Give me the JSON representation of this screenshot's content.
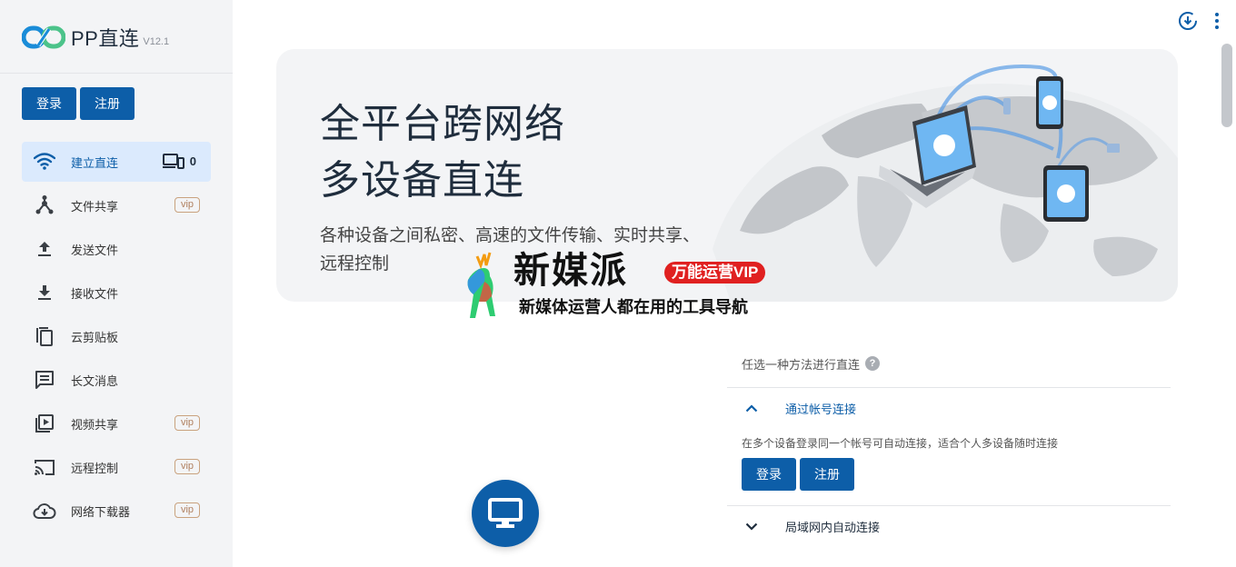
{
  "app": {
    "name": "PP直连",
    "version": "V12.1"
  },
  "auth": {
    "login_label": "登录",
    "register_label": "注册"
  },
  "sidebar": {
    "items": [
      {
        "label": "建立直连",
        "icon": "wifi-icon",
        "active": true,
        "device_count": "0"
      },
      {
        "label": "文件共享",
        "icon": "share-icon",
        "vip": "vip"
      },
      {
        "label": "发送文件",
        "icon": "upload-icon"
      },
      {
        "label": "接收文件",
        "icon": "download-icon"
      },
      {
        "label": "云剪贴板",
        "icon": "clipboard-icon"
      },
      {
        "label": "长文消息",
        "icon": "message-icon"
      },
      {
        "label": "视频共享",
        "icon": "video-icon",
        "vip": "vip"
      },
      {
        "label": "远程控制",
        "icon": "cast-icon",
        "vip": "vip"
      },
      {
        "label": "网络下载器",
        "icon": "cloud-download-icon",
        "vip": "vip"
      }
    ]
  },
  "hero": {
    "title_line1": "全平台跨网络",
    "title_line2": "多设备直连",
    "subtitle": "各种设备之间私密、高速的文件传输、实时共享、远程控制"
  },
  "watermark": {
    "brand": "新媒派",
    "badge": "万能运营VIP",
    "tagline": "新媒体运营人都在用的工具导航"
  },
  "connect": {
    "hint": "任选一种方法进行直连",
    "help": "?",
    "methods": [
      {
        "title": "通过帐号连接",
        "expanded": true,
        "description": "在多个设备登录同一个帐号可自动连接，适合个人多设备随时连接",
        "login_label": "登录",
        "register_label": "注册"
      },
      {
        "title": "局域网内自动连接",
        "expanded": false
      }
    ]
  },
  "colors": {
    "primary": "#0d5ea8",
    "active_bg": "#dbeafd",
    "sidebar_bg": "#f3f4f6",
    "vip": "#c9a27e",
    "logo_blue": "#1a8cd8",
    "logo_green": "#4cc38a"
  },
  "top_icons": [
    "download-circle-icon",
    "more-vert-icon"
  ]
}
